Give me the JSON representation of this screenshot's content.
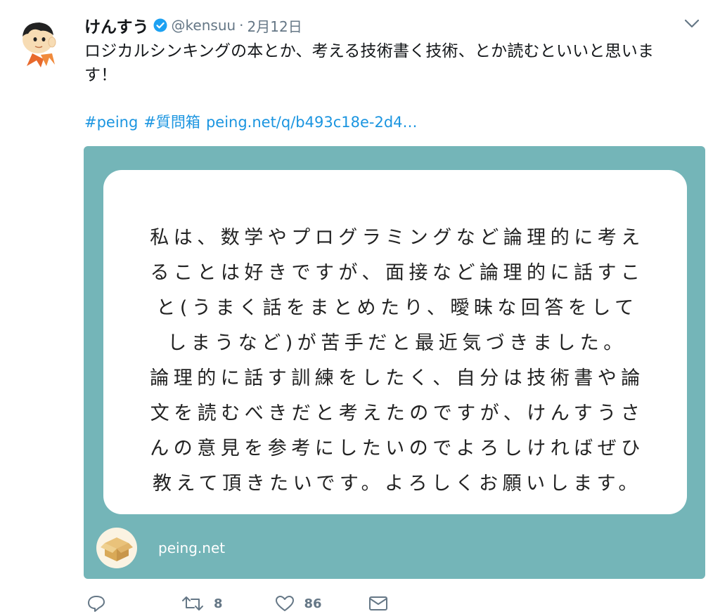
{
  "tweet": {
    "display_name": "けんすう",
    "handle": "@kensuu",
    "separator": "·",
    "date": "2月12日",
    "text_lines": [
      "ロジカルシンキングの本とか、考える技術書く技術、とか読むといいと思いま",
      "す！"
    ],
    "hashtags": [
      "#peing",
      "#質問箱"
    ],
    "link": "peing.net/q/b493c18e-2d4…"
  },
  "card": {
    "question_lines": [
      "私は、数学やプログラミングなど論理的に考え",
      "ることは好きですが、面接など論理的に話すこ",
      "と(うまく話をまとめたり、曖昧な回答をして",
      "しまうなど)が苦手だと最近気づきました。",
      "論理的に話す訓練をしたく、自分は技術書や論",
      "文を読むべきだと考えたのですが、けんすうさ",
      "んの意見を参考にしたいのでよろしければぜひ",
      "教えて頂きたいです。よろしくお願いします。"
    ],
    "site": "peing.net",
    "background_color": "#74b5b8"
  },
  "actions": {
    "retweets": "8",
    "likes": "86"
  },
  "icons": {
    "verified": "verified-badge-icon",
    "caret": "chevron-down-icon",
    "reply": "reply-icon",
    "retweet": "retweet-icon",
    "like": "heart-icon",
    "dm": "envelope-icon"
  },
  "colors": {
    "link": "#1b95e0",
    "verified": "#1da1f2",
    "secondary": "#657786"
  }
}
